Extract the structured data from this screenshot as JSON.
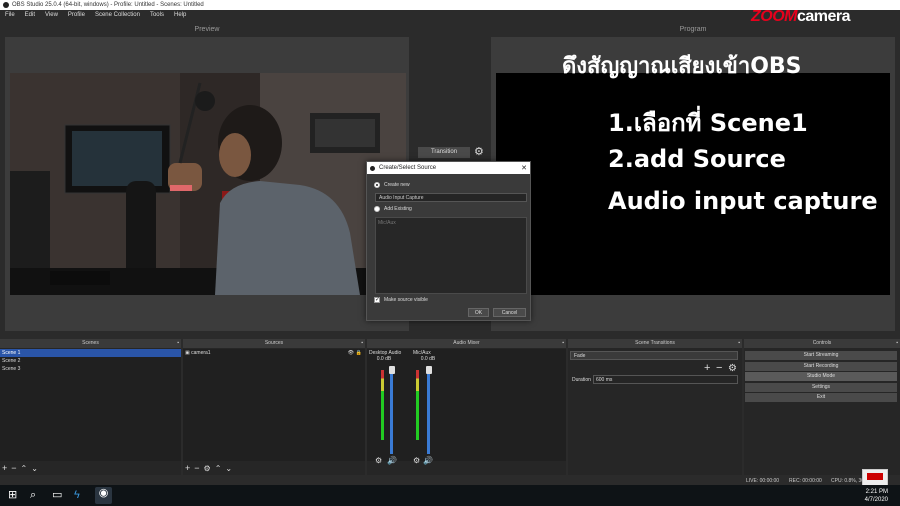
{
  "window": {
    "title": "OBS Studio 25.0.4 (64-bit, windows) - Profile: Untitled - Scenes: Untitled"
  },
  "menu": [
    "File",
    "Edit",
    "View",
    "Profile",
    "Scene Collection",
    "Tools",
    "Help"
  ],
  "preview": {
    "label": "Preview"
  },
  "program": {
    "label": "Program"
  },
  "overlay": {
    "heading": "ดึงสัญญาณเสียงเข้าOBS",
    "step1": "1.เลือกที่ Scene1",
    "step2": "2.add Source",
    "step3": "Audio input capture"
  },
  "transition_button": "Transition",
  "dialog": {
    "title": "Create/Select Source",
    "create_new": "Create new",
    "name_value": "Audio Input Capture",
    "add_existing": "Add Existing",
    "existing_item": "Mic/Aux",
    "make_visible": "Make source visible",
    "ok": "OK",
    "cancel": "Cancel"
  },
  "docks": {
    "scenes": {
      "title": "Scenes",
      "items": [
        "Scene 1",
        "Scene 2",
        "Scene 3"
      ]
    },
    "sources": {
      "title": "Sources",
      "items": [
        "camera1"
      ]
    },
    "mixer": {
      "title": "Audio Mixer",
      "channels": [
        {
          "name": "Desktop Audio",
          "db": "0.0 dB"
        },
        {
          "name": "Mic/Aux",
          "db": "0.0 dB"
        }
      ]
    },
    "transitions": {
      "title": "Scene Transitions",
      "selected": "Fade",
      "duration_label": "Duration",
      "duration_value": "600 ms"
    },
    "controls": {
      "title": "Controls",
      "buttons": [
        "Start Streaming",
        "Start Recording",
        "Studio Mode",
        "Settings",
        "Exit"
      ]
    }
  },
  "status": {
    "live": "LIVE: 00:00:00",
    "rec": "REC: 00:00:00",
    "cpu": "CPU: 0.8%, 30.00 fps"
  },
  "taskbar": {
    "time": "2:21 PM",
    "date": "4/7/2020"
  },
  "brand": {
    "zoom": "ZOOM",
    "camera": "camera",
    "zoom_color": "#e8001c"
  },
  "icons": [
    "windows-start-icon",
    "search-icon",
    "task-view-icon",
    "lightning-app-icon",
    "obs-app-icon",
    "gear-icon",
    "eye-icon",
    "lock-icon",
    "speaker-icon",
    "plus-icon",
    "minus-icon",
    "up-arrow-icon",
    "down-arrow-icon"
  ]
}
